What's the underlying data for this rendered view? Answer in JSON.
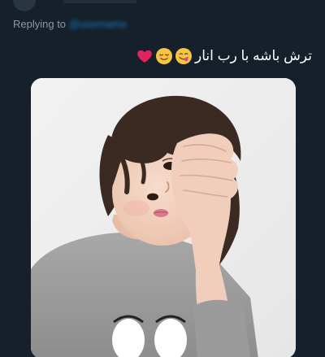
{
  "reply": {
    "prefix": "Replying to",
    "handle": "@username"
  },
  "tweet": {
    "text": "ترش باشه با رب انار",
    "emojis": [
      "yum-face-emoji",
      "relieved-face-emoji",
      "red-heart-emoji"
    ]
  },
  "media": {
    "alt": "Photo of a small child with tousled dark hair holding a hand to the forehead"
  }
}
